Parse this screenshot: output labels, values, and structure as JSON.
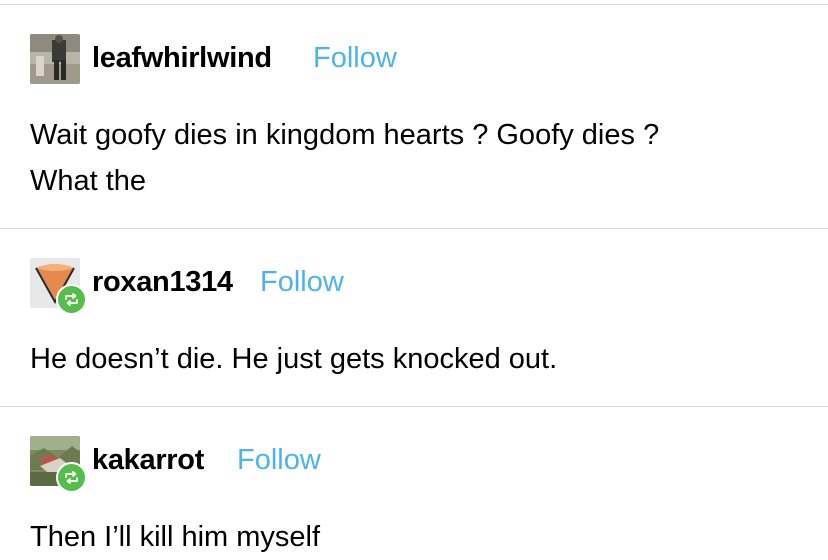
{
  "posts": [
    {
      "username": "leafwhirlwind",
      "follow_label": "Follow",
      "avatar_icon": "person-walking-photo",
      "reblogged": false,
      "lines": [
        "Wait goofy dies in kingdom hearts ? Goofy dies ?",
        "What the"
      ]
    },
    {
      "username": "roxan1314",
      "follow_label": "Follow",
      "avatar_icon": "ice-cream-cone-icon",
      "reblogged": true,
      "lines": [
        "He doesn’t die. He just gets knocked out."
      ]
    },
    {
      "username": "kakarrot",
      "follow_label": "Follow",
      "avatar_icon": "landscape-photo",
      "reblogged": true,
      "lines": [
        "Then I’ll kill him myself"
      ]
    }
  ],
  "colors": {
    "follow": "#4eb3ec",
    "reblog_badge": "#56bc4c",
    "divider": "#d6d6d6"
  }
}
